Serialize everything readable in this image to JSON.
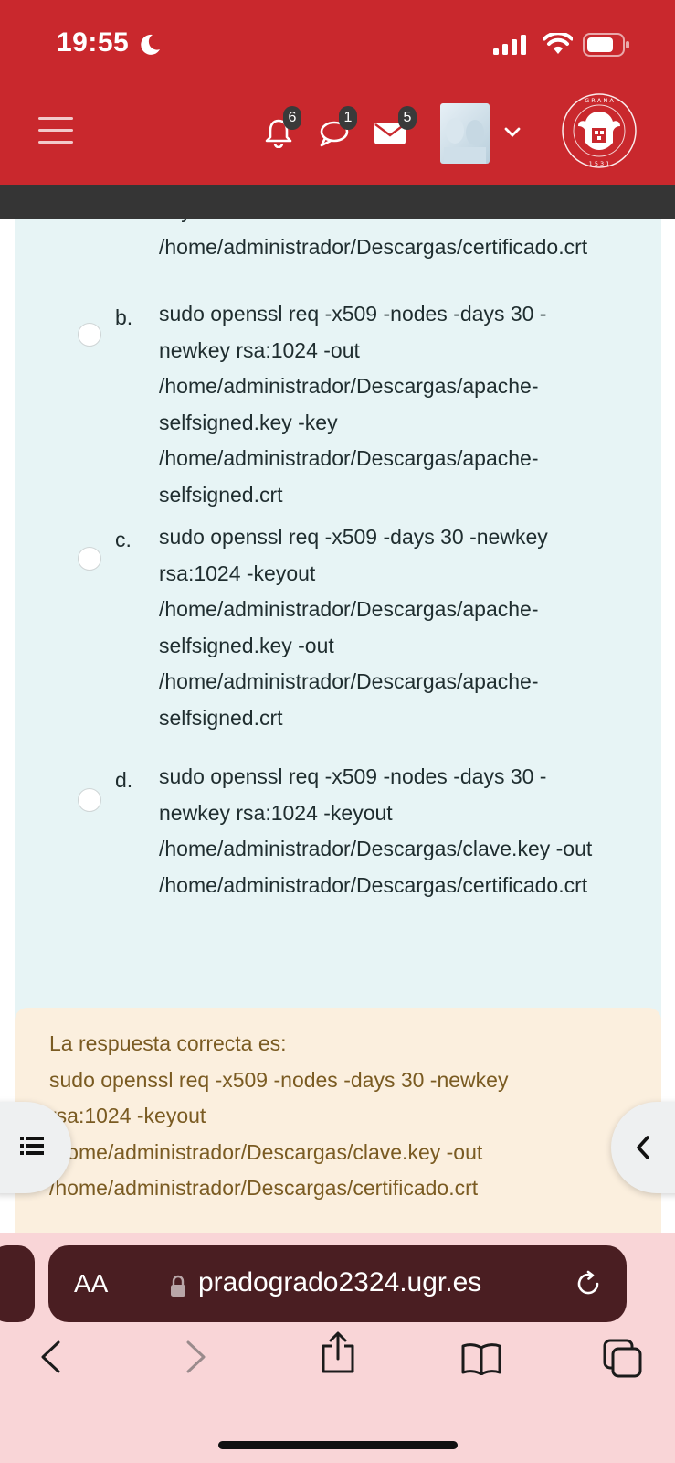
{
  "status_bar": {
    "time": "19:55"
  },
  "header": {
    "notifications_count": "6",
    "messages_count": "1",
    "mail_count": "5",
    "seal_text": "UNIVERSITAS · GRANATENSIS · 1531"
  },
  "answers": {
    "partial_option": "keyout\n/home/administrador/Descargas/certificado.crt",
    "options": [
      {
        "label": "b.",
        "text": "sudo openssl req -x509 -nodes -days 30 -\nnewkey rsa:1024 -out\n/home/administrador/Descargas/apache-\nselfsigned.key -key\n/home/administrador/Descargas/apache-\nselfsigned.crt"
      },
      {
        "label": "c.",
        "text": "sudo openssl req -x509 -days 30 -newkey\nrsa:1024 -keyout\n/home/administrador/Descargas/apache-\nselfsigned.key -out\n/home/administrador/Descargas/apache-\nselfsigned.crt"
      },
      {
        "label": "d.",
        "text": "sudo openssl req -x509 -nodes -days 30 -\nnewkey rsa:1024 -keyout\n/home/administrador/Descargas/clave.key -out\n/home/administrador/Descargas/certificado.crt"
      }
    ]
  },
  "feedback": {
    "text": "La respuesta correcta es:\nsudo openssl req -x509 -nodes -days 30 -newkey\nrsa:1024 -keyout\n/home/administrador/Descargas/clave.key -out\n/home/administrador/Descargas/certificado.crt"
  },
  "browser": {
    "text_size_label": "AA",
    "url": "pradogrado2324.ugr.es"
  },
  "icons": {
    "menu": "hamburger-icon",
    "notifications": "bell-icon",
    "messages": "chat-icon",
    "mail": "mail-icon",
    "drawer": "list-icon",
    "collapse": "chevron-left-icon",
    "back": "chevron-left-icon",
    "forward": "chevron-right-icon",
    "share": "share-icon",
    "bookmarks": "book-icon",
    "tabs": "tabs-icon"
  },
  "colors": {
    "header": "#c9282d",
    "answers_bg": "#e7f4f5",
    "feedback_bg": "#fbefde",
    "feedback_text": "#7a5b22",
    "browser_bg": "#f9d5d7",
    "urlbar": "#4a1e22"
  }
}
